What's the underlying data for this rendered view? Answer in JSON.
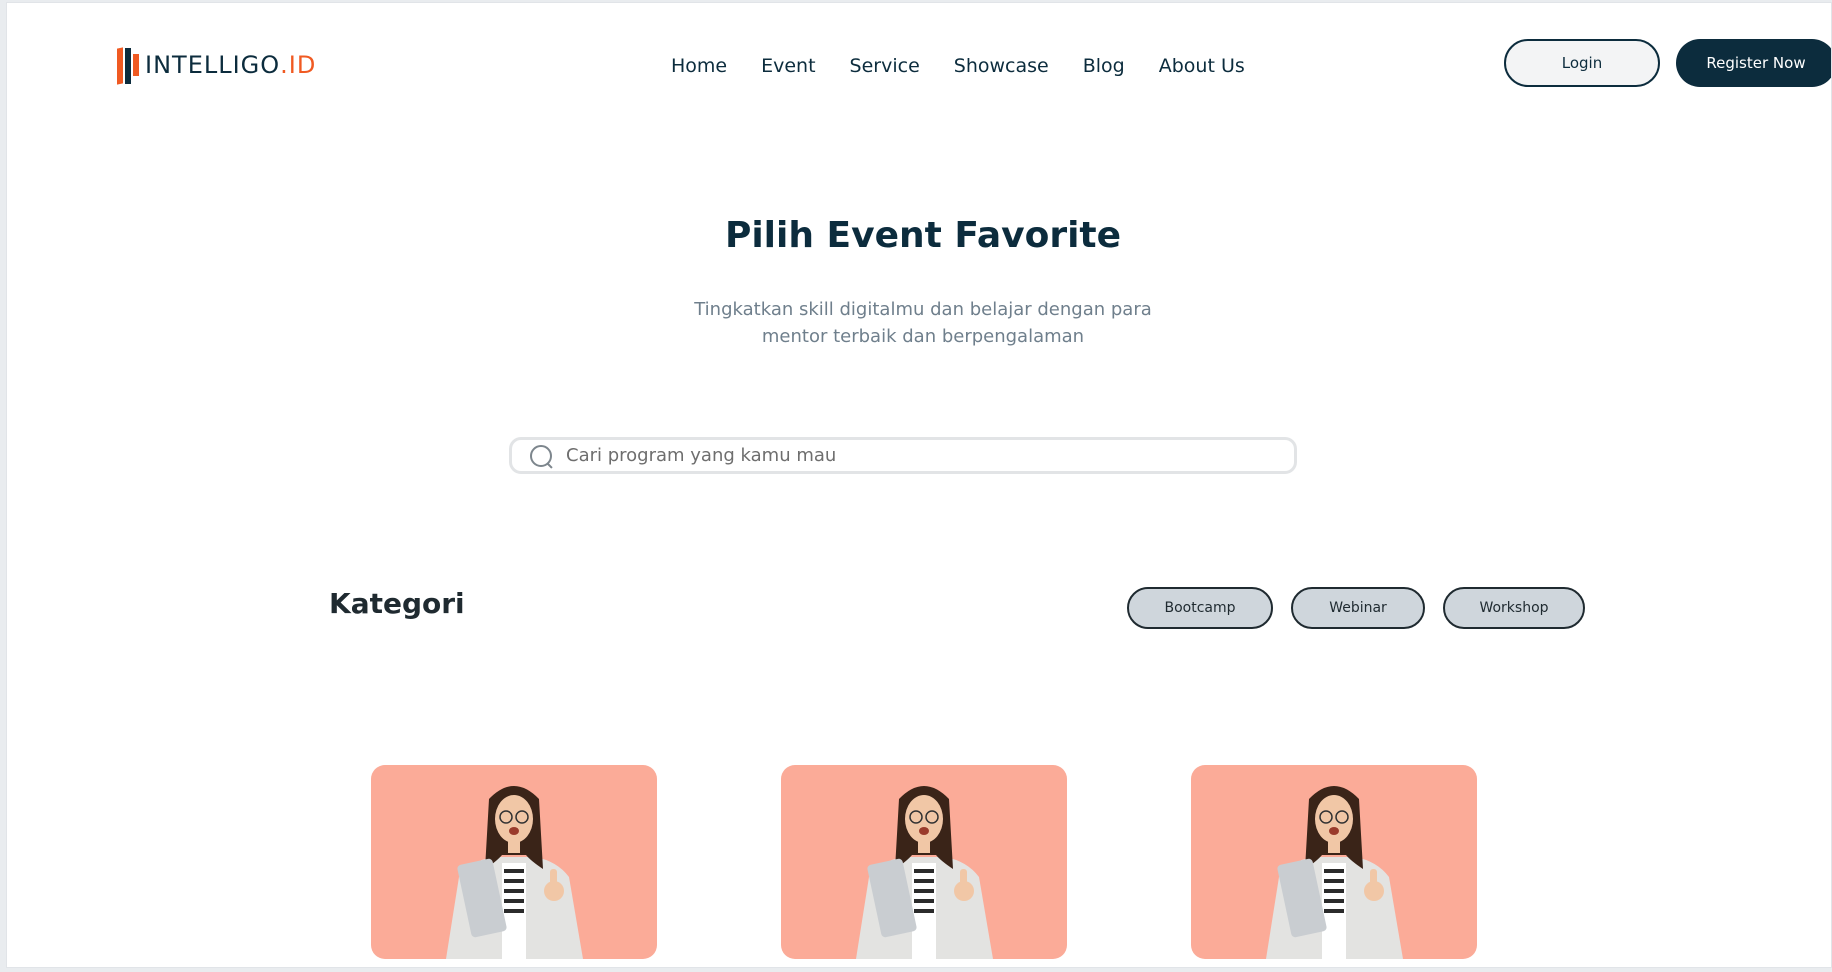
{
  "brand": {
    "name_main": "INTELLIGO",
    "name_suffix": ".ID"
  },
  "nav": {
    "items": [
      "Home",
      "Event",
      "Service",
      "Showcase",
      "Blog",
      "About Us"
    ]
  },
  "auth": {
    "login_label": "Login",
    "register_label": "Register Now"
  },
  "hero": {
    "title": "Pilih Event Favorite",
    "subtitle_line1": "Tingkatkan skill digitalmu dan belajar dengan para",
    "subtitle_line2": "mentor terbaik dan berpengalaman"
  },
  "search": {
    "placeholder": "Cari program yang kamu mau",
    "value": ""
  },
  "kategori": {
    "title": "Kategori",
    "chips": [
      "Bootcamp",
      "Webinar",
      "Workshop"
    ]
  },
  "events": {
    "cards": [
      {
        "image": "woman-with-laptop-thumbs-up"
      },
      {
        "image": "woman-with-laptop-thumbs-up"
      },
      {
        "image": "woman-with-laptop-thumbs-up"
      }
    ]
  },
  "colors": {
    "primary": "#0c2c3d",
    "accent": "#f05a22",
    "card_bg": "#fbab98",
    "chip_bg": "#cfd6dc",
    "muted_text": "#6f7f8c"
  }
}
